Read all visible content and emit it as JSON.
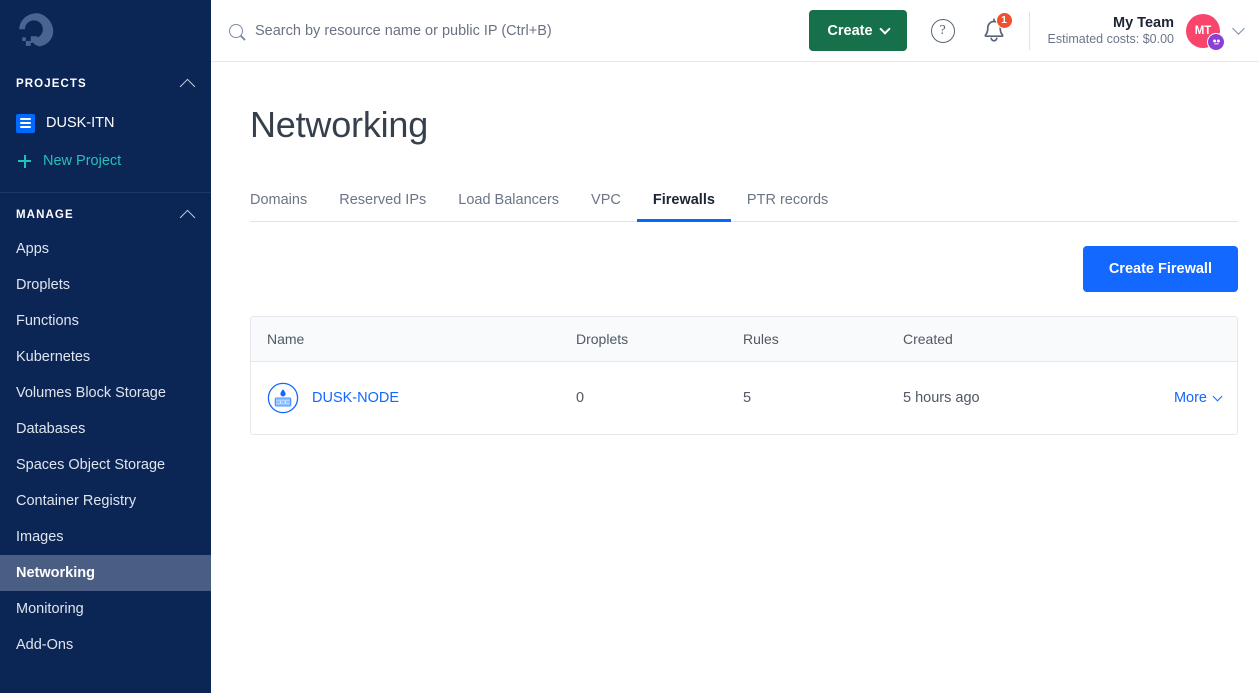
{
  "sidebar": {
    "logo": "digitalocean-logo",
    "projects": {
      "heading": "PROJECTS",
      "collapse_icon": "chevron-up-icon",
      "items": [
        {
          "label": "DUSK-ITN",
          "icon": "project-icon"
        }
      ],
      "new_project_label": "New Project",
      "new_project_icon": "plus-icon"
    },
    "manage": {
      "heading": "MANAGE",
      "collapse_icon": "chevron-up-icon",
      "items": [
        {
          "label": "Apps",
          "active": false
        },
        {
          "label": "Droplets",
          "active": false
        },
        {
          "label": "Functions",
          "active": false
        },
        {
          "label": "Kubernetes",
          "active": false
        },
        {
          "label": "Volumes Block Storage",
          "active": false
        },
        {
          "label": "Databases",
          "active": false
        },
        {
          "label": "Spaces Object Storage",
          "active": false
        },
        {
          "label": "Container Registry",
          "active": false
        },
        {
          "label": "Images",
          "active": false
        },
        {
          "label": "Networking",
          "active": true
        },
        {
          "label": "Monitoring",
          "active": false
        },
        {
          "label": "Add-Ons",
          "active": false
        }
      ]
    }
  },
  "topbar": {
    "search": {
      "icon": "search-icon",
      "placeholder": "Search by resource name or public IP (Ctrl+B)",
      "value": ""
    },
    "create_label": "Create",
    "create_chevron": "chevron-down-icon",
    "help_icon": "question-mark-icon",
    "help_glyph": "?",
    "notifications_icon": "bell-icon",
    "notifications_count": "1",
    "team_name": "My Team",
    "estimated_costs": "Estimated costs: $0.00",
    "avatar_initials": "MT",
    "avatar_badge_icon": "user-status-icon",
    "account_chevron": "chevron-down-icon"
  },
  "page": {
    "title": "Networking",
    "tabs": [
      {
        "label": "Domains",
        "active": false
      },
      {
        "label": "Reserved IPs",
        "active": false
      },
      {
        "label": "Load Balancers",
        "active": false
      },
      {
        "label": "VPC",
        "active": false
      },
      {
        "label": "Firewalls",
        "active": true
      },
      {
        "label": "PTR records",
        "active": false
      }
    ],
    "create_firewall_label": "Create Firewall",
    "table": {
      "columns": [
        "Name",
        "Droplets",
        "Rules",
        "Created",
        ""
      ],
      "rows": [
        {
          "icon": "firewall-icon",
          "name": "DUSK-NODE",
          "droplets": "0",
          "rules": "5",
          "created": "5 hours ago",
          "more_label": "More",
          "more_chevron": "chevron-down-icon"
        }
      ]
    }
  },
  "colors": {
    "sidebar_bg": "#0b2555",
    "sidebar_active_bg": "#4a5e84",
    "accent_blue": "#1268ff",
    "create_green": "#16704a",
    "badge_red": "#f1502f",
    "avatar_pink": "#f9446b",
    "teal_link": "#27c0b8"
  }
}
